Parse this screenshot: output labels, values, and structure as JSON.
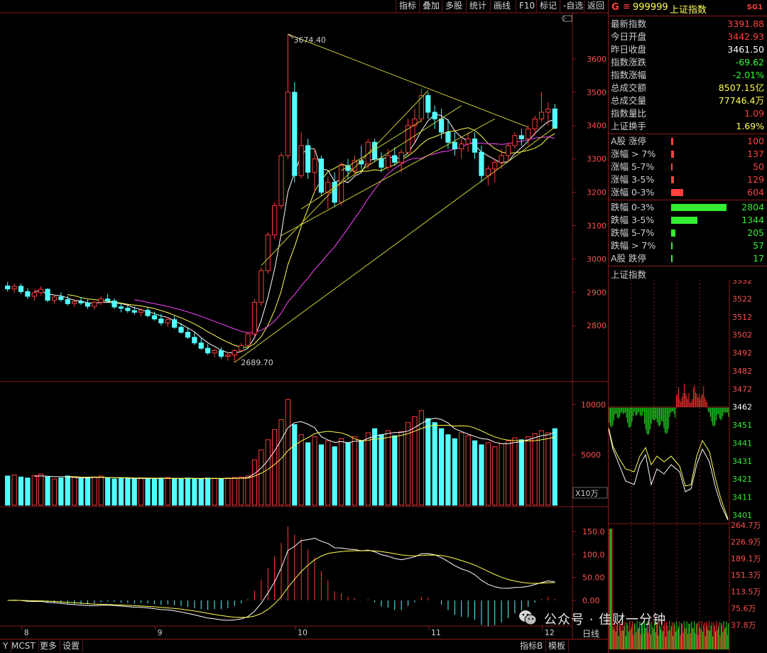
{
  "toolbar": {
    "buttons": [
      "指标",
      "叠加",
      "多股",
      "统计",
      "画线",
      "F10",
      "标记",
      "-自选",
      "返回"
    ]
  },
  "main_chart": {
    "high_label": "3674.40",
    "low_label": "2689.70",
    "price_ticks": [
      "3600",
      "3500",
      "3400",
      "3300",
      "3200",
      "3100",
      "3000",
      "2900",
      "2800"
    ],
    "volume_ticks": [
      "10000",
      "5000"
    ],
    "volume_unit": "X10万",
    "macd_ticks": [
      "150.0",
      "100.0",
      "50.00",
      "0.00"
    ],
    "date_ticks": [
      "8",
      "9",
      "10",
      "11",
      "12"
    ],
    "period_label": "日线",
    "colors": {
      "up": "#ff3b3b",
      "down": "#54ffff",
      "ma5": "#ffffff",
      "ma10": "#ffff4d",
      "ma20": "#ff44ff",
      "trend": "#cccc33",
      "grid": "#8a1a1a"
    }
  },
  "chart_data": {
    "type": "candlestick",
    "ohlc": [
      [
        2919,
        2931,
        2902,
        2910
      ],
      [
        2910,
        2925,
        2898,
        2918
      ],
      [
        2918,
        2926,
        2895,
        2902
      ],
      [
        2902,
        2912,
        2880,
        2888
      ],
      [
        2888,
        2905,
        2875,
        2899
      ],
      [
        2899,
        2918,
        2890,
        2909
      ],
      [
        2909,
        2912,
        2870,
        2876
      ],
      [
        2876,
        2892,
        2866,
        2886
      ],
      [
        2886,
        2900,
        2872,
        2878
      ],
      [
        2878,
        2890,
        2860,
        2866
      ],
      [
        2866,
        2880,
        2855,
        2872
      ],
      [
        2872,
        2886,
        2862,
        2868
      ],
      [
        2868,
        2878,
        2850,
        2858
      ],
      [
        2858,
        2874,
        2848,
        2870
      ],
      [
        2870,
        2888,
        2862,
        2880
      ],
      [
        2880,
        2895,
        2870,
        2874
      ],
      [
        2874,
        2882,
        2850,
        2856
      ],
      [
        2856,
        2866,
        2840,
        2852
      ],
      [
        2852,
        2860,
        2838,
        2845
      ],
      [
        2845,
        2858,
        2832,
        2840
      ],
      [
        2840,
        2852,
        2828,
        2846
      ],
      [
        2846,
        2854,
        2825,
        2830
      ],
      [
        2830,
        2842,
        2815,
        2820
      ],
      [
        2820,
        2835,
        2800,
        2808
      ],
      [
        2808,
        2825,
        2795,
        2818
      ],
      [
        2818,
        2830,
        2790,
        2795
      ],
      [
        2795,
        2808,
        2775,
        2780
      ],
      [
        2780,
        2792,
        2760,
        2765
      ],
      [
        2765,
        2780,
        2742,
        2748
      ],
      [
        2748,
        2762,
        2728,
        2732
      ],
      [
        2732,
        2745,
        2712,
        2718
      ],
      [
        2718,
        2730,
        2705,
        2725
      ],
      [
        2725,
        2735,
        2700,
        2708
      ],
      [
        2708,
        2720,
        2695,
        2712
      ],
      [
        2712,
        2730,
        2689.7,
        2725
      ],
      [
        2725,
        2748,
        2720,
        2740
      ],
      [
        2740,
        2780,
        2735,
        2775
      ],
      [
        2775,
        2880,
        2770,
        2870
      ],
      [
        2870,
        2975,
        2860,
        2965
      ],
      [
        2965,
        3080,
        2955,
        3072
      ],
      [
        3072,
        3170,
        3060,
        3160
      ],
      [
        3160,
        3320,
        3150,
        3310
      ],
      [
        3310,
        3674.4,
        3300,
        3500
      ],
      [
        3500,
        3530,
        3230,
        3250
      ],
      [
        3250,
        3380,
        3240,
        3340
      ],
      [
        3340,
        3360,
        3240,
        3260
      ],
      [
        3260,
        3330,
        3200,
        3300
      ],
      [
        3300,
        3310,
        3190,
        3200
      ],
      [
        3200,
        3245,
        3150,
        3230
      ],
      [
        3230,
        3260,
        3155,
        3170
      ],
      [
        3170,
        3290,
        3160,
        3280
      ],
      [
        3280,
        3300,
        3240,
        3265
      ],
      [
        3265,
        3310,
        3250,
        3295
      ],
      [
        3295,
        3340,
        3270,
        3285
      ],
      [
        3285,
        3360,
        3270,
        3350
      ],
      [
        3350,
        3360,
        3290,
        3300
      ],
      [
        3300,
        3320,
        3260,
        3275
      ],
      [
        3275,
        3330,
        3265,
        3310
      ],
      [
        3310,
        3335,
        3280,
        3290
      ],
      [
        3290,
        3330,
        3260,
        3320
      ],
      [
        3320,
        3420,
        3310,
        3400
      ],
      [
        3400,
        3450,
        3350,
        3420
      ],
      [
        3420,
        3510,
        3410,
        3490
      ],
      [
        3490,
        3500,
        3420,
        3440
      ],
      [
        3440,
        3460,
        3390,
        3420
      ],
      [
        3420,
        3450,
        3360,
        3380
      ],
      [
        3380,
        3420,
        3330,
        3350
      ],
      [
        3350,
        3380,
        3310,
        3330
      ],
      [
        3330,
        3360,
        3300,
        3345
      ],
      [
        3345,
        3380,
        3320,
        3360
      ],
      [
        3360,
        3380,
        3300,
        3320
      ],
      [
        3320,
        3340,
        3230,
        3250
      ],
      [
        3250,
        3280,
        3220,
        3270
      ],
      [
        3270,
        3300,
        3230,
        3290
      ],
      [
        3290,
        3330,
        3270,
        3310
      ],
      [
        3310,
        3350,
        3290,
        3340
      ],
      [
        3340,
        3380,
        3330,
        3370
      ],
      [
        3370,
        3390,
        3340,
        3360
      ],
      [
        3360,
        3400,
        3340,
        3390
      ],
      [
        3390,
        3430,
        3370,
        3420
      ],
      [
        3420,
        3500,
        3410,
        3440
      ],
      [
        3440,
        3470,
        3400,
        3450
      ],
      [
        3450,
        3465,
        3390,
        3391.88
      ]
    ],
    "volume": [
      2900,
      3000,
      2800,
      2700,
      2950,
      3100,
      2800,
      2600,
      2700,
      2900,
      2750,
      2650,
      2700,
      2800,
      2900,
      2700,
      2600,
      2650,
      2700,
      2600,
      2700,
      2650,
      2600,
      2700,
      2750,
      2650,
      2600,
      2700,
      2650,
      2600,
      2700,
      2650,
      2600,
      2700,
      2750,
      2800,
      2900,
      4500,
      5500,
      6500,
      7500,
      8500,
      10500,
      8000,
      7000,
      6200,
      6800,
      6000,
      6400,
      5800,
      6600,
      6200,
      6800,
      6400,
      7200,
      7600,
      7000,
      7400,
      6900,
      7300,
      8200,
      8800,
      9400,
      8600,
      8200,
      7600,
      7000,
      6600,
      7200,
      6900,
      6400,
      6000,
      6200,
      5800,
      6100,
      6400,
      6700,
      6500,
      6800,
      7100,
      7400,
      7200,
      7600
    ]
  },
  "panel": {
    "header": {
      "code": "999999",
      "name": "上证指数",
      "tag": "SG1",
      "g_label": "G"
    },
    "stats": [
      {
        "label": "最新指数",
        "value": "3391.88",
        "color": "#ff4040"
      },
      {
        "label": "今日开盘",
        "value": "3442.93",
        "color": "#ff4040"
      },
      {
        "label": "昨日收盘",
        "value": "3461.50",
        "color": "#ffffff"
      },
      {
        "label": "指数涨跌",
        "value": "-69.62",
        "color": "#33ff33"
      },
      {
        "label": "指数涨幅",
        "value": "-2.01%",
        "color": "#33ff33"
      },
      {
        "label": "总成交额",
        "value": "8507.15亿",
        "color": "#ffff55"
      },
      {
        "label": "总成交量",
        "value": "77746.4万",
        "color": "#ffff55"
      },
      {
        "label": "指数量比",
        "value": "1.09",
        "color": "#ff4040"
      },
      {
        "label": "上证换手",
        "value": "1.69%",
        "color": "#ffff55"
      }
    ],
    "up_breadth": [
      {
        "label": "A股 涨停",
        "value": "100",
        "frac": 0.036
      },
      {
        "label": "涨幅 > 7%",
        "value": "137",
        "frac": 0.049
      },
      {
        "label": "涨幅 5-7%",
        "value": "50",
        "frac": 0.018
      },
      {
        "label": "涨幅 3-5%",
        "value": "129",
        "frac": 0.046
      },
      {
        "label": "涨幅 0-3%",
        "value": "604",
        "frac": 0.215
      }
    ],
    "down_breadth": [
      {
        "label": "跌幅 0-3%",
        "value": "2804",
        "frac": 1.0
      },
      {
        "label": "跌幅 3-5%",
        "value": "1344",
        "frac": 0.479
      },
      {
        "label": "跌幅 5-7%",
        "value": "205",
        "frac": 0.073
      },
      {
        "label": "跌幅 > 7%",
        "value": "57",
        "frac": 0.02
      },
      {
        "label": "A股 跌停",
        "value": "17",
        "frac": 0.006
      }
    ],
    "mini_title": "上证指数",
    "mini_ticks": [
      "3532",
      "3522",
      "3512",
      "3502",
      "3492",
      "3482",
      "3472",
      "3462",
      "3451",
      "3441",
      "3431",
      "3421",
      "3411",
      "3401"
    ],
    "mini_vol_ticks": [
      "264.7万",
      "226.9万",
      "189.1万",
      "151.3万",
      "113.5万",
      "75.6万",
      "37.8万"
    ]
  },
  "bottom": {
    "left_buttons": [
      "Y",
      "MCST",
      "更多",
      "设置"
    ],
    "right_buttons": [
      "指标B",
      "模板"
    ]
  },
  "watermark": {
    "text": "公众号 · 佳财一分钟"
  }
}
